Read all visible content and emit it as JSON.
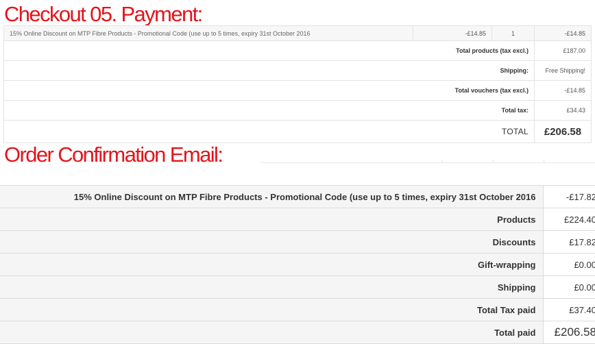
{
  "checkout": {
    "heading": "Checkout 05. Payment:",
    "item": {
      "description": "15% Online Discount on MTP Fibre Products - Promotional Code (use up to 5 times, expiry 31st October 2016",
      "unit_price": "-£14.85",
      "quantity": "1",
      "total": "-£14.85"
    },
    "summary": [
      {
        "label": "Total products (tax excl.)",
        "value": "£187.00"
      },
      {
        "label": "Shipping:",
        "value": "Free Shipping!"
      },
      {
        "label": "Total vouchers (tax excl.)",
        "value": "-£14.85"
      },
      {
        "label": "Total tax:",
        "value": "£34.43"
      }
    ],
    "total": {
      "label": "TOTAL",
      "value": "£206.58"
    }
  },
  "email": {
    "heading": "Order Confirmation Email:",
    "rows": [
      {
        "label": "15% Online Discount on MTP Fibre Products - Promotional Code (use up to 5 times, expiry 31st October 2016",
        "value": "-£17.82"
      },
      {
        "label": "Products",
        "value": "£224.40"
      },
      {
        "label": "Discounts",
        "value": "£17.82"
      },
      {
        "label": "Gift-wrapping",
        "value": "£0.00"
      },
      {
        "label": "Shipping",
        "value": "£0.00"
      },
      {
        "label": "Total Tax paid",
        "value": "£37.40"
      },
      {
        "label": "Total paid",
        "value": "£206.58"
      }
    ]
  },
  "colors": {
    "heading": "#e4141b",
    "row_shade": "#f5f5f5",
    "border": "#dddddd"
  }
}
